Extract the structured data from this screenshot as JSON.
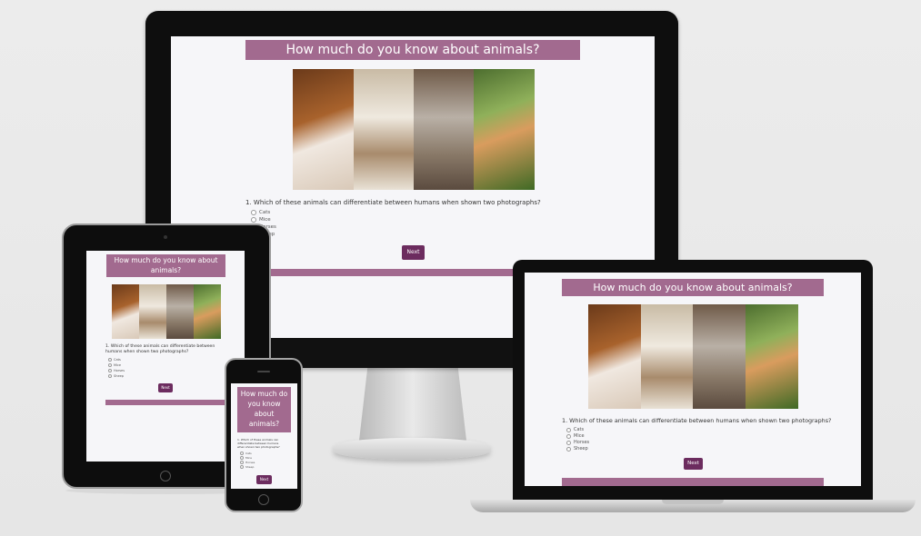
{
  "quiz": {
    "title": "How much do you know about animals?",
    "phone_title_1": "How much do",
    "phone_title_2": "you know",
    "phone_title_3": "about",
    "phone_title_4": "animals?",
    "tablet_title_1": "How much do you know about",
    "tablet_title_2": "animals?",
    "question": "1. Which of these animals can differentiate between humans when shown two photographs?",
    "tablet_question_1": "1. Which of these animals can differentiate between",
    "tablet_question_2": "humans when shown two photographs?",
    "phone_question_1": "1. Which of these animals can",
    "phone_question_2": "differentiate between humans",
    "phone_question_3": "when shown two photographs?",
    "options": [
      "Cats",
      "Mice",
      "Horses",
      "Sheep"
    ],
    "next_label": "Next"
  },
  "colors": {
    "accent": "#a26a8f",
    "button": "#6c2c5f",
    "page_bg": "#f6f6f9"
  },
  "devices": [
    "desktop-monitor",
    "laptop",
    "tablet",
    "phone"
  ]
}
